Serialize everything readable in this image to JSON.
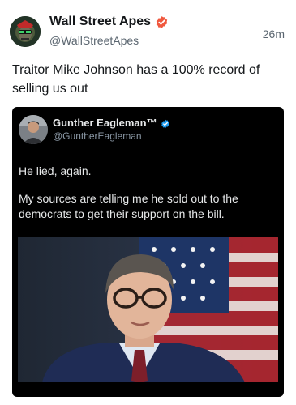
{
  "post": {
    "author_name": "Wall Street Apes",
    "author_handle": "@WallStreetApes",
    "timestamp": "26m",
    "text": "Traitor Mike Johnson has a 100% record of selling us out"
  },
  "quoted_post": {
    "author_name": "Gunther Eagleman™",
    "author_handle": "@GuntherEagleman",
    "paragraph_1": "He lied,  again.",
    "paragraph_2": "My sources are telling me he sold out to the democrats to get their support on the bill."
  },
  "icons": {
    "verified_primary": "verified-badge-orange",
    "verified_quoted": "verified-badge-blue"
  },
  "colors": {
    "verified_orange": "#f0583e",
    "verified_blue": "#1d9bf0",
    "embed_background": "#000000"
  }
}
